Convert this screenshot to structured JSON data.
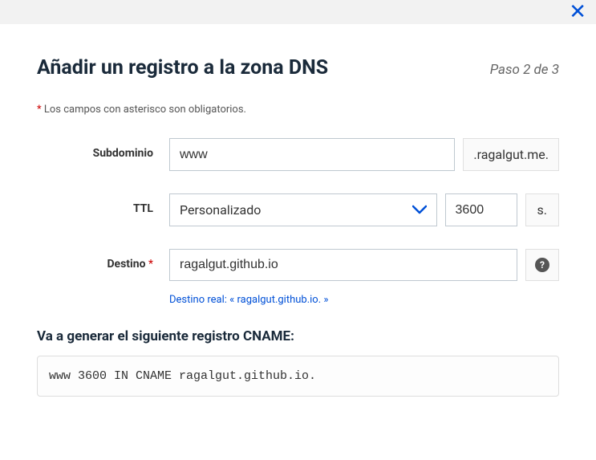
{
  "header": {
    "title": "Añadir un registro a la zona DNS",
    "step": "Paso 2 de 3"
  },
  "required_note": "Los campos con asterisco son obligatorios.",
  "form": {
    "subdomain": {
      "label": "Subdominio",
      "value": "www",
      "suffix": ".ragalgut.me."
    },
    "ttl": {
      "label": "TTL",
      "select_value": "Personalizado",
      "input_value": "3600",
      "unit": "s."
    },
    "destino": {
      "label": "Destino",
      "asterisk": "*",
      "value": "ragalgut.github.io",
      "note": "Destino real: « ragalgut.github.io. »"
    }
  },
  "preview": {
    "title": "Va a generar el siguiente registro CNAME:",
    "record": "www 3600 IN CNAME ragalgut.github.io."
  }
}
